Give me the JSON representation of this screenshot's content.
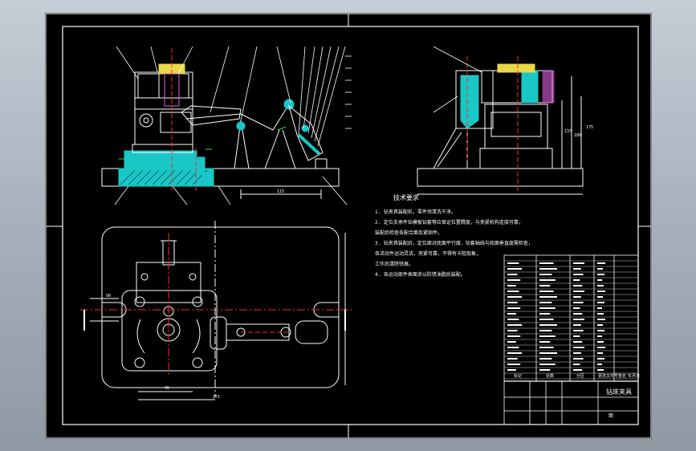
{
  "drawing": {
    "tech_req_title": "技术要求",
    "tech_req_lines": [
      "1. 钻夹具装配前，零件须清洗干净。",
      "2. 定位支承件钻模板钻套等应保证位置精度，与夹紧机构连接可靠，",
      "   装配后检查各配合面及紧固件。",
      "3. 钻夹具装配后，定位面对底面平行度、钻套轴线与底面垂直度需检查，",
      "   各活动件运动灵活，夹紧可靠，不得有卡阻现象，",
      "   工作后清除铁屑。",
      "4. 各运动部件表面涂以防锈油脂后装配。"
    ],
    "title_block": {
      "name": "钻床夹具",
      "row_labels": [
        "标记",
        "处数",
        "分区",
        "更改文件号",
        "签名",
        "年月日"
      ],
      "sheet_no": "图"
    },
    "dimension_texts": [
      "115",
      "96",
      "175",
      "137",
      "180",
      "271",
      "90"
    ]
  },
  "colors": {
    "sheet_bg": "#000000",
    "line": "#ffffff",
    "hatch_cyan": "#19c7c7",
    "hidden_red": "#ff2a2a",
    "pink": "#e060e0",
    "yellow": "#e8d84a",
    "green": "#38d84a"
  }
}
